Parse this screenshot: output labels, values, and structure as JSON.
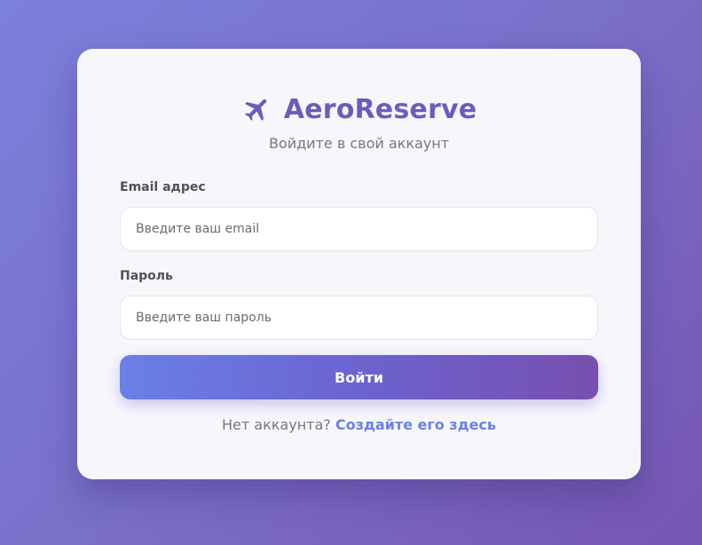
{
  "brand": {
    "icon": "airplane-icon",
    "title": "AeroReserve",
    "subtitle": "Войдите в свой аккаунт"
  },
  "form": {
    "email": {
      "label": "Email адрес",
      "placeholder": "Введите ваш email",
      "value": ""
    },
    "password": {
      "label": "Пароль",
      "placeholder": "Введите ваш пароль",
      "value": ""
    },
    "submit_label": "Войти"
  },
  "footer": {
    "prompt": "Нет аккаунта?",
    "link_text": "Создайте его здесь"
  },
  "colors": {
    "accent": "#6a5cbf",
    "link": "#6a80e6",
    "button_start": "#6a80e6",
    "button_end": "#774faf",
    "card_bg": "#f7f7fb"
  }
}
